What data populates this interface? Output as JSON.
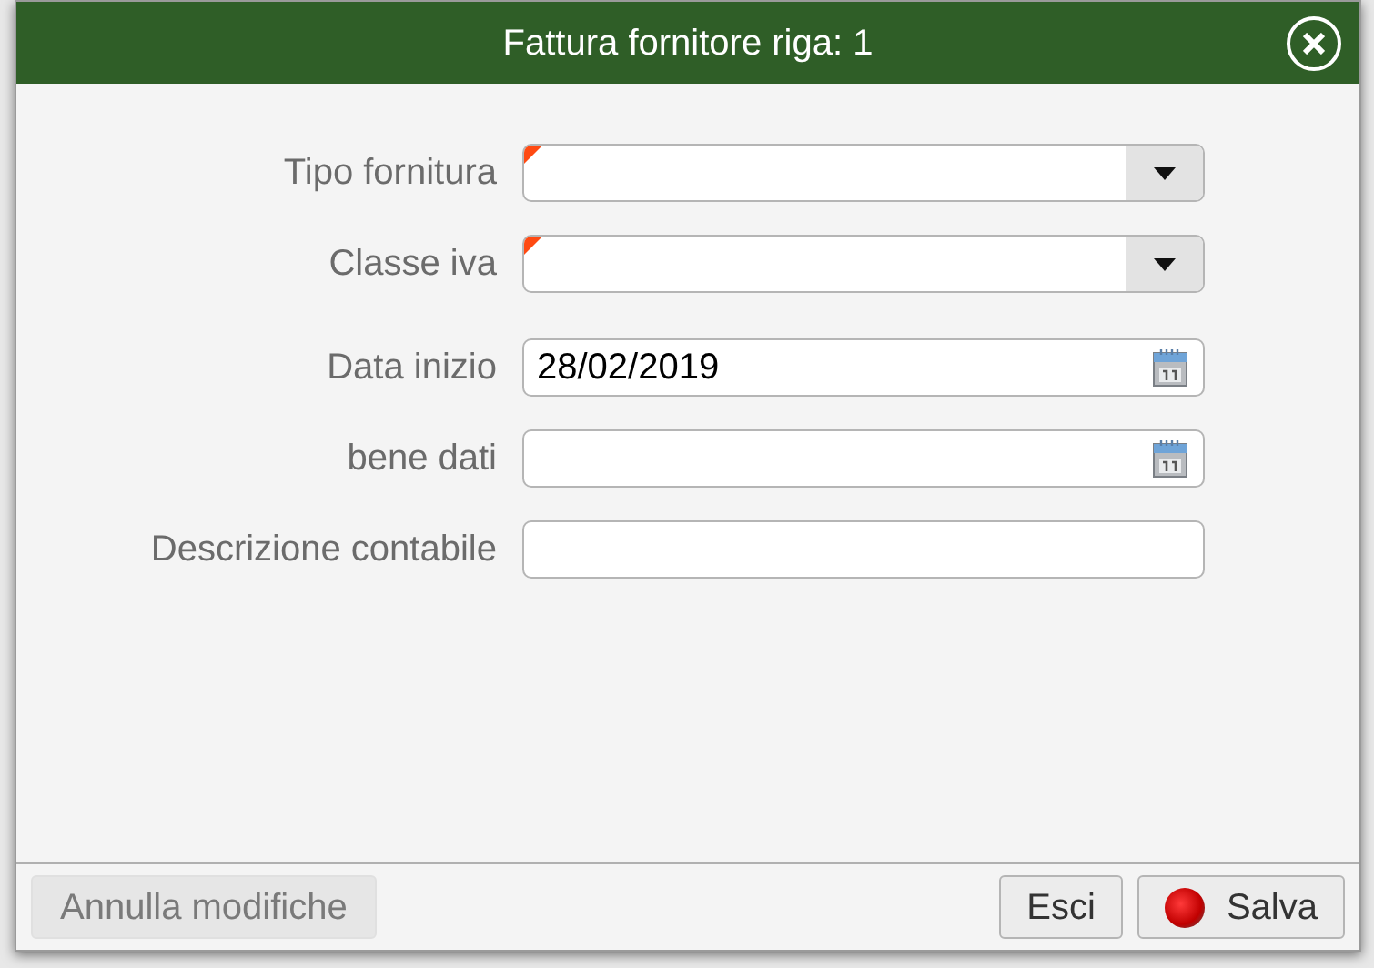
{
  "dialog": {
    "title": "Fattura fornitore riga: 1"
  },
  "field_groups": [
    [
      {
        "label": "Tipo fornitura",
        "kind": "select",
        "required": true
      },
      {
        "label": "Classe iva",
        "kind": "select",
        "required": true
      }
    ],
    [
      {
        "label": "Data inizio",
        "kind": "date",
        "value": "28/02/2019",
        "required": false
      },
      {
        "label": "bene dati",
        "kind": "date",
        "required": false
      },
      {
        "label": "Descrizione contabile",
        "kind": "text",
        "required": false
      }
    ]
  ],
  "footer": {
    "left_buttons": [
      {
        "label": "Annulla modifiche",
        "disabled": true
      }
    ],
    "right_buttons": [
      {
        "label": "Esci",
        "kind": "plain"
      },
      {
        "label": "Salva",
        "kind": "status"
      }
    ]
  }
}
